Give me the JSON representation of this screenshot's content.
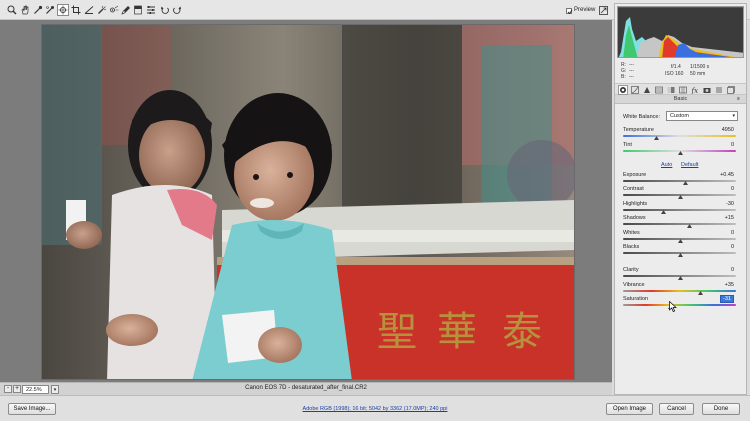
{
  "toolbar": {
    "tools": [
      "zoom-tool-icon",
      "hand-tool-icon",
      "white-balance-tool-icon",
      "color-sampler-icon",
      "targeted-adjustment-icon",
      "crop-tool-icon",
      "straighten-tool-icon",
      "spot-removal-icon",
      "red-eye-removal-icon",
      "adjustment-brush-icon",
      "graduated-filter-icon",
      "preferences-icon",
      "rotate-ccw-icon",
      "rotate-cw-icon"
    ],
    "active_tool": "targeted-adjustment-icon",
    "preview_label": "Preview",
    "preview_checked": true
  },
  "image": {
    "subject": "photo"
  },
  "status": {
    "zoom_value": "22.5%",
    "zoom_out": "-",
    "zoom_in": "+",
    "filename": "Canon EOS 7D  -  desaturated_after_final.CR2"
  },
  "histogram": {
    "background": "#3b3b3b"
  },
  "readout": {
    "r_label": "R:",
    "g_label": "G:",
    "b_label": "B:",
    "r_value": "---",
    "g_value": "---",
    "b_value": "---",
    "aperture": "f/1.4",
    "shutter": "1/1500 s",
    "iso": "ISO 160",
    "focal": "50 mm"
  },
  "panel": {
    "title": "Basic",
    "white_balance_label": "White Balance:",
    "white_balance_value": "Custom",
    "auto_label": "Auto",
    "default_label": "Default",
    "sliders": [
      {
        "label": "Temperature",
        "value": "4950",
        "pos": 0.29
      },
      {
        "label": "Tint",
        "value": "0",
        "pos": 0.5
      },
      {
        "label": "Exposure",
        "value": "+0.45",
        "pos": 0.55
      },
      {
        "label": "Contrast",
        "value": "0",
        "pos": 0.5
      },
      {
        "label": "Highlights",
        "value": "-30",
        "pos": 0.35
      },
      {
        "label": "Shadows",
        "value": "+15",
        "pos": 0.58
      },
      {
        "label": "Whites",
        "value": "0",
        "pos": 0.5
      },
      {
        "label": "Blacks",
        "value": "0",
        "pos": 0.5
      },
      {
        "label": "Clarity",
        "value": "0",
        "pos": 0.5
      },
      {
        "label": "Vibrance",
        "value": "+35",
        "pos": 0.68
      },
      {
        "label": "Saturation",
        "value": "-31",
        "pos": 0.42
      }
    ]
  },
  "bottom": {
    "save_label": "Save Image...",
    "workflow_text": "Adobe RGB (1998); 16 bit; 5042 by 3362 (17.0MP); 240 ppi",
    "open_label": "Open Image",
    "cancel_label": "Cancel",
    "done_label": "Done"
  },
  "colors": {
    "accent": "#3a78d8",
    "link": "#1a3fa6"
  }
}
